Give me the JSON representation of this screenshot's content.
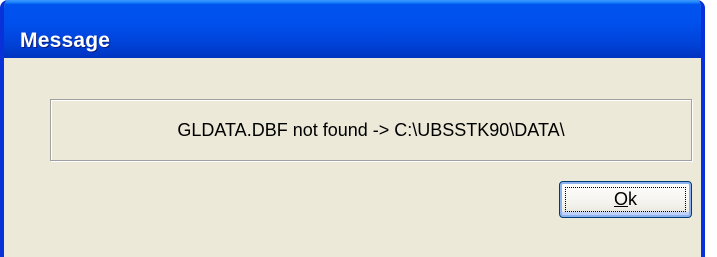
{
  "window": {
    "title": "Message",
    "titlebar_color": "#0050ee",
    "frame_color": "#0831d9",
    "background_color": "#ece9d8"
  },
  "message": {
    "text": "GLDATA.DBF not found -> C:\\UBSSTK90\\DATA\\"
  },
  "ok_button": {
    "accelerator": "O",
    "rest": "k"
  }
}
